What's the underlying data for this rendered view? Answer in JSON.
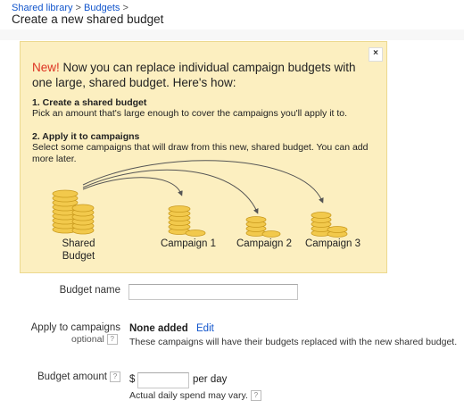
{
  "breadcrumb": {
    "items": [
      "Shared library",
      "Budgets"
    ],
    "separator": ">"
  },
  "page_title": "Create a new shared budget",
  "promo": {
    "close_glyph": "×",
    "new_label": "New!",
    "headline": "Now you can replace individual campaign budgets with one large, shared budget. Here's how:",
    "step1_title": "1. Create a shared budget",
    "step1_desc": "Pick an amount that's large enough to cover the campaigns you'll apply it to.",
    "step2_title": "2. Apply it to campaigns",
    "step2_desc": "Select some campaigns that will draw from this new, shared budget. You can add more later.",
    "illustration": {
      "shared_label_1": "Shared",
      "shared_label_2": "Budget",
      "campaigns": [
        "Campaign 1",
        "Campaign 2",
        "Campaign 3"
      ],
      "coin_color": "#f2c94c",
      "coin_edge": "#c99a1e"
    }
  },
  "form": {
    "budget_name": {
      "label": "Budget name",
      "value": "",
      "placeholder": ""
    },
    "apply": {
      "label": "Apply to campaigns",
      "optional": "optional",
      "value": "None added",
      "edit": "Edit",
      "hint": "These campaigns will have their budgets replaced with the new shared budget."
    },
    "amount": {
      "label": "Budget amount",
      "currency": "$",
      "value": "",
      "per_day": "per day",
      "hint": "Actual daily spend may vary."
    },
    "help_glyph": "?"
  },
  "colors": {
    "link": "#1155cc",
    "new": "#dd3322",
    "promo_bg": "#fcefc0"
  }
}
